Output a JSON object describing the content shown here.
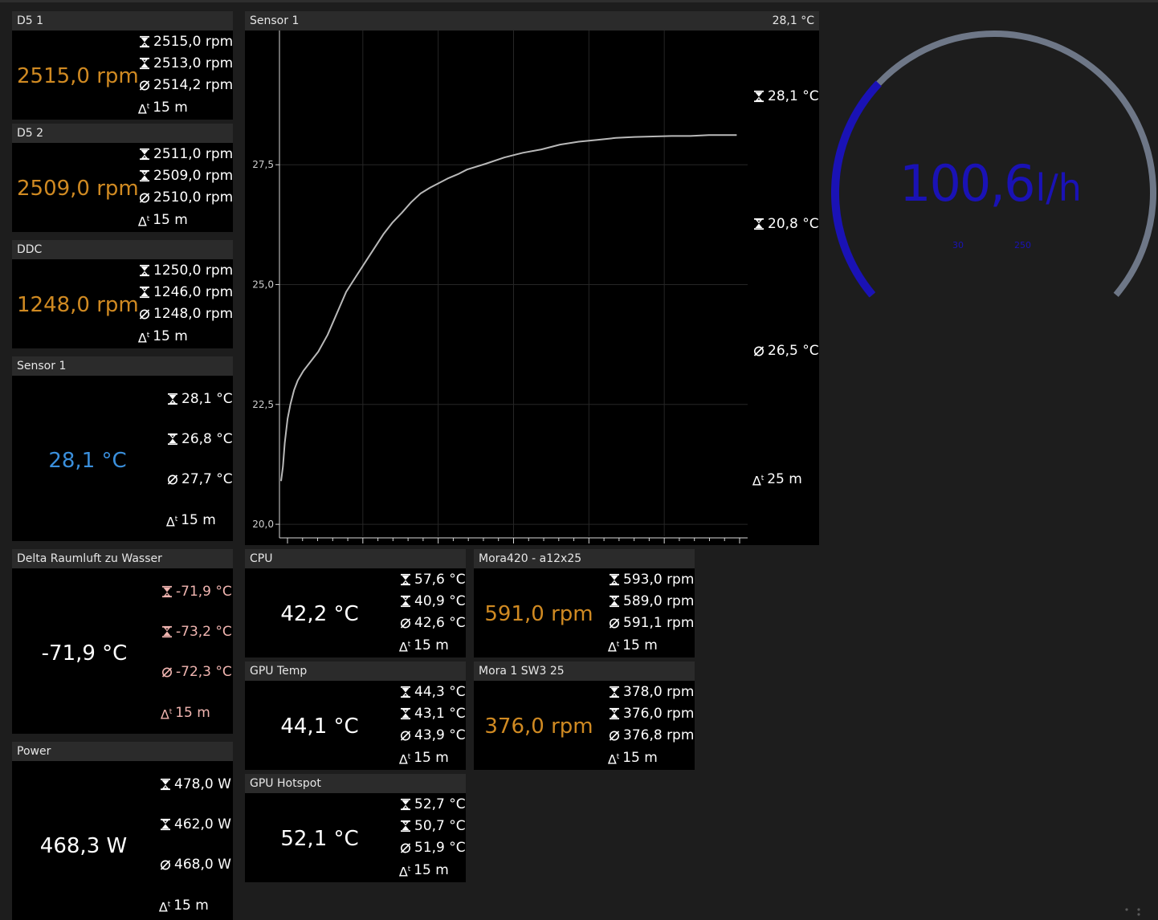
{
  "colors": {
    "background": "#1d1d1d",
    "panel": "#000000",
    "header": "#2b2b2b",
    "rpm_value": "#d08a22",
    "temp_value": "#3a8fdc",
    "delta_stats": "#f0b5b0",
    "gauge_track": "#6e7787",
    "gauge_fill": "#1a12b5",
    "chart_line": "#b9b9b9"
  },
  "icons": {
    "max": "max-icon",
    "min": "min-icon",
    "avg": "avg-icon",
    "timespan": "delta-t-icon"
  },
  "panels": {
    "d5_1": {
      "title": "D5 1",
      "value": "2515,0 rpm",
      "max": "2515,0 rpm",
      "min": "2513,0 rpm",
      "avg": "2514,2 rpm",
      "span": "15 m"
    },
    "d5_2": {
      "title": "D5 2",
      "value": "2509,0 rpm",
      "max": "2511,0 rpm",
      "min": "2509,0 rpm",
      "avg": "2510,0 rpm",
      "span": "15 m"
    },
    "ddc": {
      "title": "DDC",
      "value": "1248,0 rpm",
      "max": "1250,0 rpm",
      "min": "1246,0 rpm",
      "avg": "1248,0 rpm",
      "span": "15 m"
    },
    "sensor1": {
      "title": "Sensor 1",
      "value": "28,1 °C",
      "max": "28,1 °C",
      "min": "26,8 °C",
      "avg": "27,7 °C",
      "span": "15 m"
    },
    "delta": {
      "title": "Delta Raumluft zu Wasser",
      "value": "-71,9 °C",
      "max": "-71,9 °C",
      "min": "-73,2 °C",
      "avg": "-72,3 °C",
      "span": "15 m"
    },
    "power": {
      "title": "Power",
      "value": "468,3 W",
      "max": "478,0 W",
      "min": "462,0 W",
      "avg": "468,0 W",
      "span": "15 m"
    },
    "cpu": {
      "title": "CPU",
      "value": "42,2 °C",
      "max": "57,6 °C",
      "min": "40,9 °C",
      "avg": "42,6 °C",
      "span": "15 m"
    },
    "gpu_temp": {
      "title": "GPU Temp",
      "value": "44,1 °C",
      "max": "44,3 °C",
      "min": "43,1 °C",
      "avg": "43,9 °C",
      "span": "15 m"
    },
    "gpu_hotspot": {
      "title": "GPU Hotspot",
      "value": "52,1 °C",
      "max": "52,7 °C",
      "min": "50,7 °C",
      "avg": "51,9 °C",
      "span": "15 m"
    },
    "mora420": {
      "title": "Mora420 - a12x25",
      "value": "591,0 rpm",
      "max": "593,0 rpm",
      "min": "589,0 rpm",
      "avg": "591,1 rpm",
      "span": "15 m"
    },
    "mora1": {
      "title": "Mora 1 SW3 25",
      "value": "376,0 rpm",
      "max": "378,0 rpm",
      "min": "376,0 rpm",
      "avg": "376,8 rpm",
      "span": "15 m"
    }
  },
  "chart_panel": {
    "title": "Sensor 1",
    "current": "28,1 °C",
    "max": "28,1 °C",
    "min": "20,8 °C",
    "avg": "26,5 °C",
    "span": "25 m"
  },
  "gauge": {
    "value_number": "100,6",
    "unit": "l/h",
    "scale_min": "30",
    "scale_max": "250",
    "value": 100.6,
    "min": 30,
    "max": 250
  },
  "chart_data": {
    "type": "line",
    "title": "Sensor 1",
    "xlabel": "",
    "ylabel": "",
    "ylim": [
      19.75,
      30.3
    ],
    "xlim": [
      0,
      25
    ],
    "yticks": [
      20.0,
      22.5,
      25.0,
      27.5
    ],
    "ytick_labels": [
      "20,0",
      "22,5",
      "25,0",
      "27,5"
    ],
    "grid": true,
    "series": [
      {
        "x": [
          0,
          0.1,
          0.2,
          0.35,
          0.5,
          0.7,
          0.9,
          1.2,
          1.6,
          2.0,
          2.5,
          3.0,
          3.5,
          4.0,
          4.5,
          5.0,
          5.5,
          6.0,
          6.5,
          7.0,
          7.5,
          8.0,
          8.5,
          9.0,
          9.5,
          10.0,
          11.0,
          12.0,
          13.0,
          14.0,
          15.0,
          16.0,
          17.0,
          18.0,
          19.0,
          20.0,
          21.0,
          22.0,
          23.0,
          24.0,
          24.5
        ],
        "y": [
          20.9,
          21.2,
          21.7,
          22.2,
          22.5,
          22.8,
          23.0,
          23.2,
          23.4,
          23.6,
          23.95,
          24.4,
          24.85,
          25.15,
          25.45,
          25.75,
          26.05,
          26.3,
          26.5,
          26.72,
          26.9,
          27.02,
          27.12,
          27.22,
          27.3,
          27.4,
          27.52,
          27.65,
          27.75,
          27.82,
          27.92,
          27.98,
          28.02,
          28.06,
          28.08,
          28.09,
          28.1,
          28.1,
          28.12,
          28.12,
          28.12
        ]
      }
    ]
  }
}
